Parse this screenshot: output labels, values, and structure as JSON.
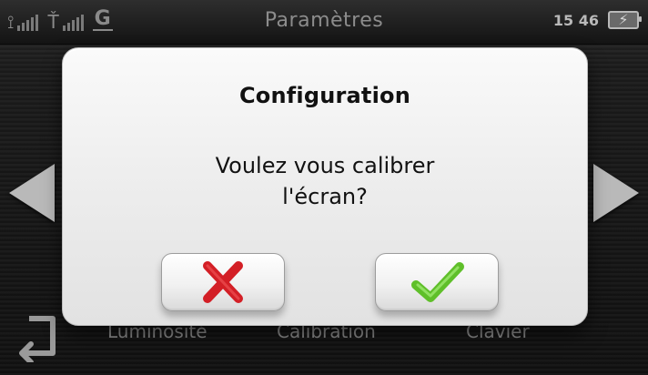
{
  "status_bar": {
    "gps_icon": "gps-antenna-icon",
    "gsm_icon": "gsm-antenna-icon",
    "network_type": "G",
    "title": "Paramètres",
    "time": "15 46",
    "battery_icon": "battery-charging-icon"
  },
  "dialog": {
    "title": "Configuration",
    "message_line1": "Voulez vous calibrer",
    "message_line2": "l'écran?",
    "cancel_icon": "red-x-icon",
    "confirm_icon": "green-check-icon",
    "colors": {
      "cancel": "#d31f26",
      "confirm": "#5fbf2a"
    }
  },
  "background_menu": {
    "items": [
      "Luminosité",
      "Calibration",
      "Clavier"
    ],
    "back_icon": "return-arrow-icon"
  },
  "navigation": {
    "left_icon": "left-arrow-icon",
    "right_icon": "right-arrow-icon"
  }
}
